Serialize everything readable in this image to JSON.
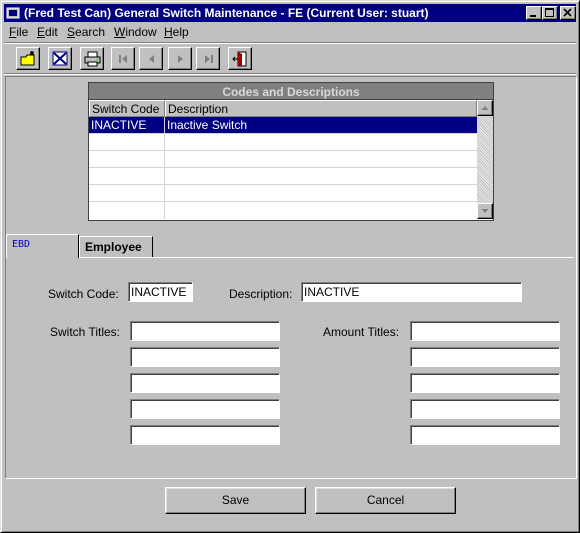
{
  "window": {
    "title": "(Fred Test Can) General Switch Maintenance - FE (Current User: stuart)"
  },
  "menu": {
    "items": [
      {
        "key": "F",
        "rest": "ile"
      },
      {
        "key": "E",
        "rest": "dit"
      },
      {
        "key": "S",
        "rest": "earch"
      },
      {
        "key": "W",
        "rest": "indow"
      },
      {
        "key": "H",
        "rest": "elp"
      }
    ]
  },
  "toolbar": {
    "buttons": [
      "new-icon",
      "delete-icon",
      "print-icon",
      "first-record-icon",
      "previous-record-icon",
      "next-record-icon",
      "last-record-icon",
      "exit-icon"
    ]
  },
  "grid": {
    "title": "Codes and Descriptions",
    "columns": [
      "Switch Code",
      "Description"
    ],
    "rows": [
      {
        "code": "INACTIVE",
        "description": "Inactive Switch",
        "selected": true
      }
    ]
  },
  "tabs": [
    {
      "label": "EBD",
      "active": true
    },
    {
      "label": "Employee",
      "active": false
    }
  ],
  "form": {
    "switch_code_label": "Switch Code:",
    "switch_code_value": "INACTIVE",
    "description_label": "Description:",
    "description_value": "INACTIVE",
    "switch_titles_label": "Switch Titles:",
    "switch_titles": [
      "",
      "",
      "",
      "",
      ""
    ],
    "amount_titles_label": "Amount Titles:",
    "amount_titles": [
      "",
      "",
      "",
      "",
      ""
    ]
  },
  "actions": {
    "save_label": "Save",
    "cancel_label": "Cancel"
  },
  "colors": {
    "titlebar": "#000080",
    "selection": "#000080",
    "face": "#c0c0c0",
    "tab_active_text": "#0000c0"
  }
}
